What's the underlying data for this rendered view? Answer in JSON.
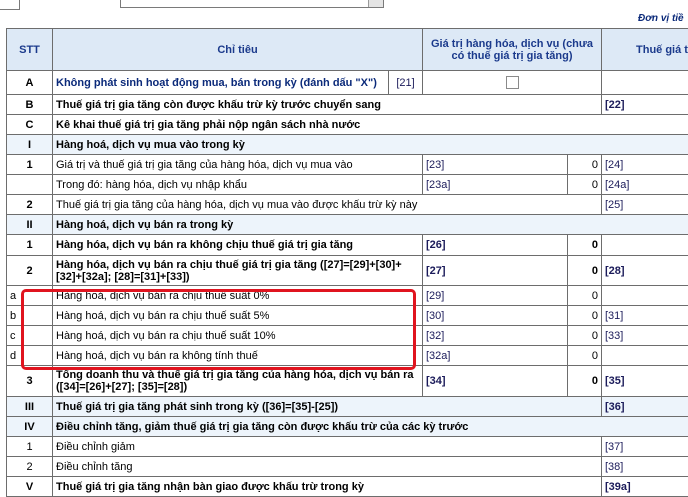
{
  "unit_label": "Đơn vị tiề",
  "headers": {
    "stt": "STT",
    "chitieu": "Chỉ tiêu",
    "giatri": "Giá trị hàng hóa, dịch vụ (chưa có thuế giá trị gia tăng)",
    "thue": "Thuế giá t"
  },
  "rows": [
    {
      "stt": "A",
      "label": "Không phát sinh hoạt động mua, bán trong kỳ (đánh dấu \"X\")",
      "code1": "[21]",
      "value1": "",
      "code2": "",
      "bold": true,
      "checkbox": true
    },
    {
      "stt": "B",
      "label": "Thuế giá trị gia tăng còn được khấu trừ kỳ trước chuyển sang",
      "code2": "[22]",
      "bold": true
    },
    {
      "stt": "C",
      "label": "Kê khai thuế giá trị gia tăng phải nộp ngân sách nhà nước",
      "bold": true
    },
    {
      "stt": "I",
      "label": "Hàng hoá, dịch vụ mua vào trong kỳ",
      "bold": true
    },
    {
      "stt": "1",
      "label": "Giá trị và thuế giá trị gia tăng của hàng hóa, dịch vụ mua vào",
      "code1": "[23]",
      "value1": "0",
      "code2": "[24]"
    },
    {
      "stt": "",
      "label": "Trong đó: hàng hóa, dịch vụ nhập khẩu",
      "code1": "[23a]",
      "value1": "0",
      "code2": "[24a]"
    },
    {
      "stt": "2",
      "label": "Thuế giá trị gia tăng của hàng hóa, dịch vụ mua vào được khấu trừ kỳ này",
      "code2": "[25]"
    },
    {
      "stt": "II",
      "label": "Hàng hoá, dịch vụ bán ra trong kỳ",
      "bold": true
    },
    {
      "stt": "1",
      "label": "Hàng hóa, dịch vụ bán ra không chịu thuế giá trị gia tăng",
      "code1": "[26]",
      "value1": "0",
      "bold": true
    },
    {
      "stt": "2",
      "label": "Hàng hóa, dịch vụ bán ra chịu thuế giá trị gia tăng ([27]=[29]+[30]+[32]+[32a]; [28]=[31]+[33])",
      "code1": "[27]",
      "value1": "0",
      "code2": "[28]",
      "bold": true
    },
    {
      "stt": "a",
      "label": "Hàng hoá, dịch vụ bán ra chịu thuế suất 0%",
      "code1": "[29]",
      "value1": "0"
    },
    {
      "stt": "b",
      "label": "Hàng hoá, dịch vụ bán ra chịu thuế suất 5%",
      "code1": "[30]",
      "value1": "0",
      "code2": "[31]"
    },
    {
      "stt": "c",
      "label": "Hàng hoá, dịch vụ bán ra chịu thuế suất 10%",
      "code1": "[32]",
      "value1": "0",
      "code2": "[33]"
    },
    {
      "stt": "d",
      "label": "Hàng hoá, dịch vụ bán ra không tính thuế",
      "code1": "[32a]",
      "value1": "0"
    },
    {
      "stt": "3",
      "label": "Tổng doanh thu và thuế giá trị gia tăng của hàng hóa, dịch vụ bán ra ([34]=[26]+[27]; [35]=[28])",
      "code1": "[34]",
      "value1": "0",
      "code2": "[35]",
      "bold": true
    },
    {
      "stt": "III",
      "label": "Thuế giá trị gia tăng phát sinh trong kỳ ([36]=[35]-[25])",
      "code2": "[36]",
      "bold": true
    },
    {
      "stt": "IV",
      "label": "Điều chỉnh tăng, giảm thuế giá trị gia tăng còn được khấu trừ của các kỳ trước",
      "bold": true
    },
    {
      "stt": "1",
      "label": "Điều chỉnh giảm",
      "code2": "[37]"
    },
    {
      "stt": "2",
      "label": "Điều chỉnh tăng",
      "code2": "[38]"
    },
    {
      "stt": "V",
      "label": "Thuế giá trị gia tăng nhận bàn giao được khấu trừ trong kỳ",
      "code2": "[39a]",
      "bold": true
    }
  ]
}
